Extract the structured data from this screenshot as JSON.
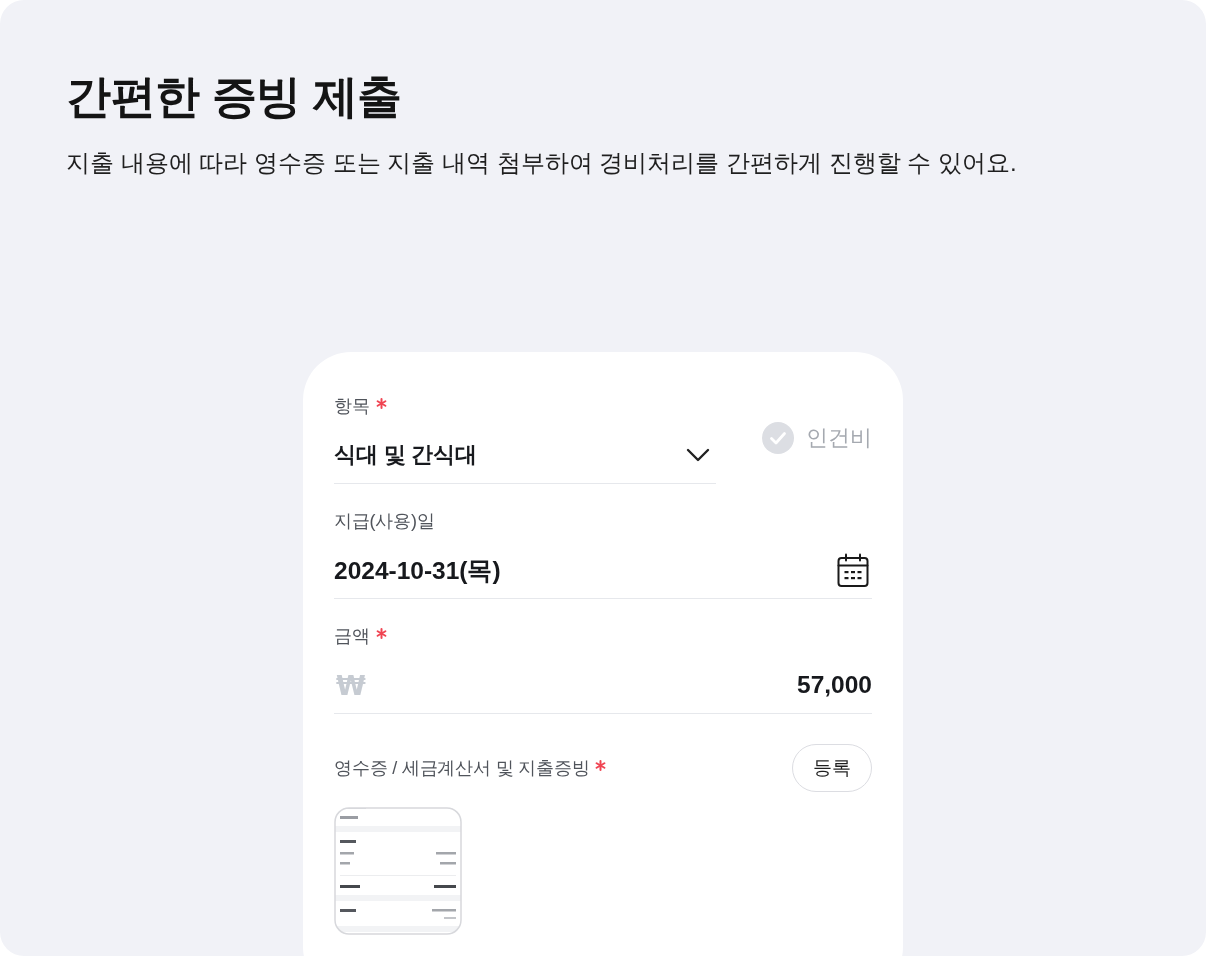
{
  "header": {
    "title": "간편한 증빙 제출",
    "description": "지출 내용에 따라 영수증 또는 지출 내역 첨부하여 경비처리를 간편하게 진행할 수 있어요."
  },
  "form": {
    "fields": [
      {
        "kind": "select",
        "label": "항목",
        "required": true,
        "value": "식대 및 간식대",
        "option": {
          "label": "인건비",
          "checked": false
        }
      },
      {
        "kind": "date",
        "label": "지급(사용)일",
        "required": false,
        "value": "2024-10-31(목)"
      },
      {
        "kind": "amount",
        "label": "금액",
        "required": true,
        "currency": "₩",
        "value": "57,000"
      },
      {
        "kind": "attachment",
        "label": "영수증 / 세금계산서 및 지출증빙",
        "required": true,
        "button": "등록",
        "attachments": [
          {
            "kind": "image"
          }
        ]
      }
    ]
  }
}
